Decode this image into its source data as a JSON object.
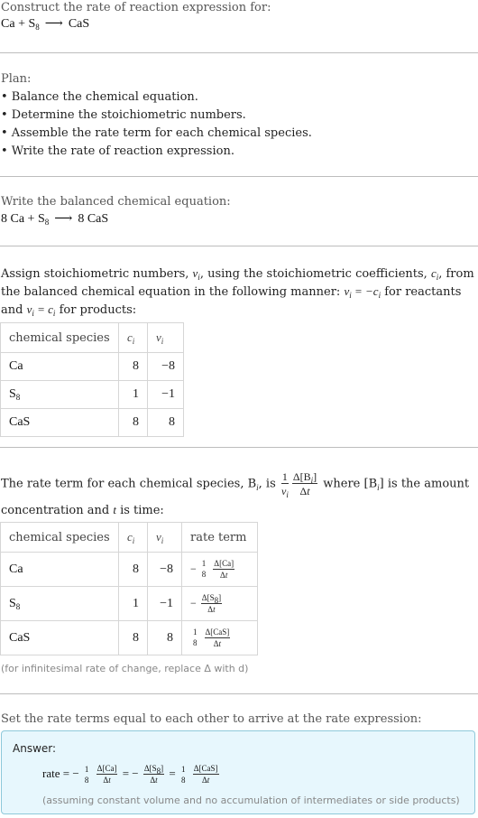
{
  "header": {
    "prompt": "Construct the rate of reaction expression for:",
    "reaction": {
      "reactants": [
        "Ca",
        "S8"
      ],
      "products": [
        "CaS"
      ],
      "arrow": "⟶"
    }
  },
  "plan": {
    "title": "Plan:",
    "steps": [
      "• Balance the chemical equation.",
      "• Determine the stoichiometric numbers.",
      "• Assemble the rate term for each chemical species.",
      "• Write the rate of reaction expression."
    ]
  },
  "balanced": {
    "title": "Write the balanced chemical equation:",
    "coef_ca": "8",
    "coef_cas": "8"
  },
  "stoich": {
    "text1": "Assign stoichiometric numbers, ",
    "text2": ", using the stoichiometric coefficients, ",
    "text3": ", from",
    "line2a": "the balanced chemical equation in the following manner: ",
    "line2b": " for reactants",
    "line3a": "and ",
    "line3b": " for products:",
    "table": {
      "headers": [
        "chemical species",
        "c_i",
        "ν_i"
      ],
      "rows": [
        {
          "species": "Ca",
          "c": "8",
          "nu": "−8"
        },
        {
          "species": "S8",
          "c": "1",
          "nu": "−1"
        },
        {
          "species": "CaS",
          "c": "8",
          "nu": "8"
        }
      ]
    }
  },
  "rate_terms": {
    "line1a": "The rate term for each chemical species, B",
    "line1b": ", is ",
    "line1c": " where [B",
    "line1d": "] is the amount",
    "line2a": "concentration and ",
    "line2b": " is time:",
    "table": {
      "headers": [
        "chemical species",
        "c_i",
        "ν_i",
        "rate term"
      ],
      "rows": [
        {
          "species": "Ca",
          "c": "8",
          "nu": "−8",
          "term_sign": "−",
          "term_coef": "1/8",
          "term_species": "Ca"
        },
        {
          "species": "S8",
          "c": "1",
          "nu": "−1",
          "term_sign": "−",
          "term_coef": "",
          "term_species": "S8"
        },
        {
          "species": "CaS",
          "c": "8",
          "nu": "8",
          "term_sign": "",
          "term_coef": "1/8",
          "term_species": "CaS"
        }
      ]
    },
    "note": "(for infinitesimal rate of change, replace Δ with d)"
  },
  "final": {
    "title": "Set the rate terms equal to each other to arrive at the rate expression:",
    "answer_label": "Answer:",
    "rate_word": "rate",
    "assumption": "(assuming constant volume and no accumulation of intermediates or side products)"
  },
  "colors": {
    "divider": "#bdbdbd",
    "table_border": "#d6d6d6",
    "answer_bg": "#e7f7fd",
    "answer_border": "#8ec9da",
    "muted_text": "#888888"
  }
}
